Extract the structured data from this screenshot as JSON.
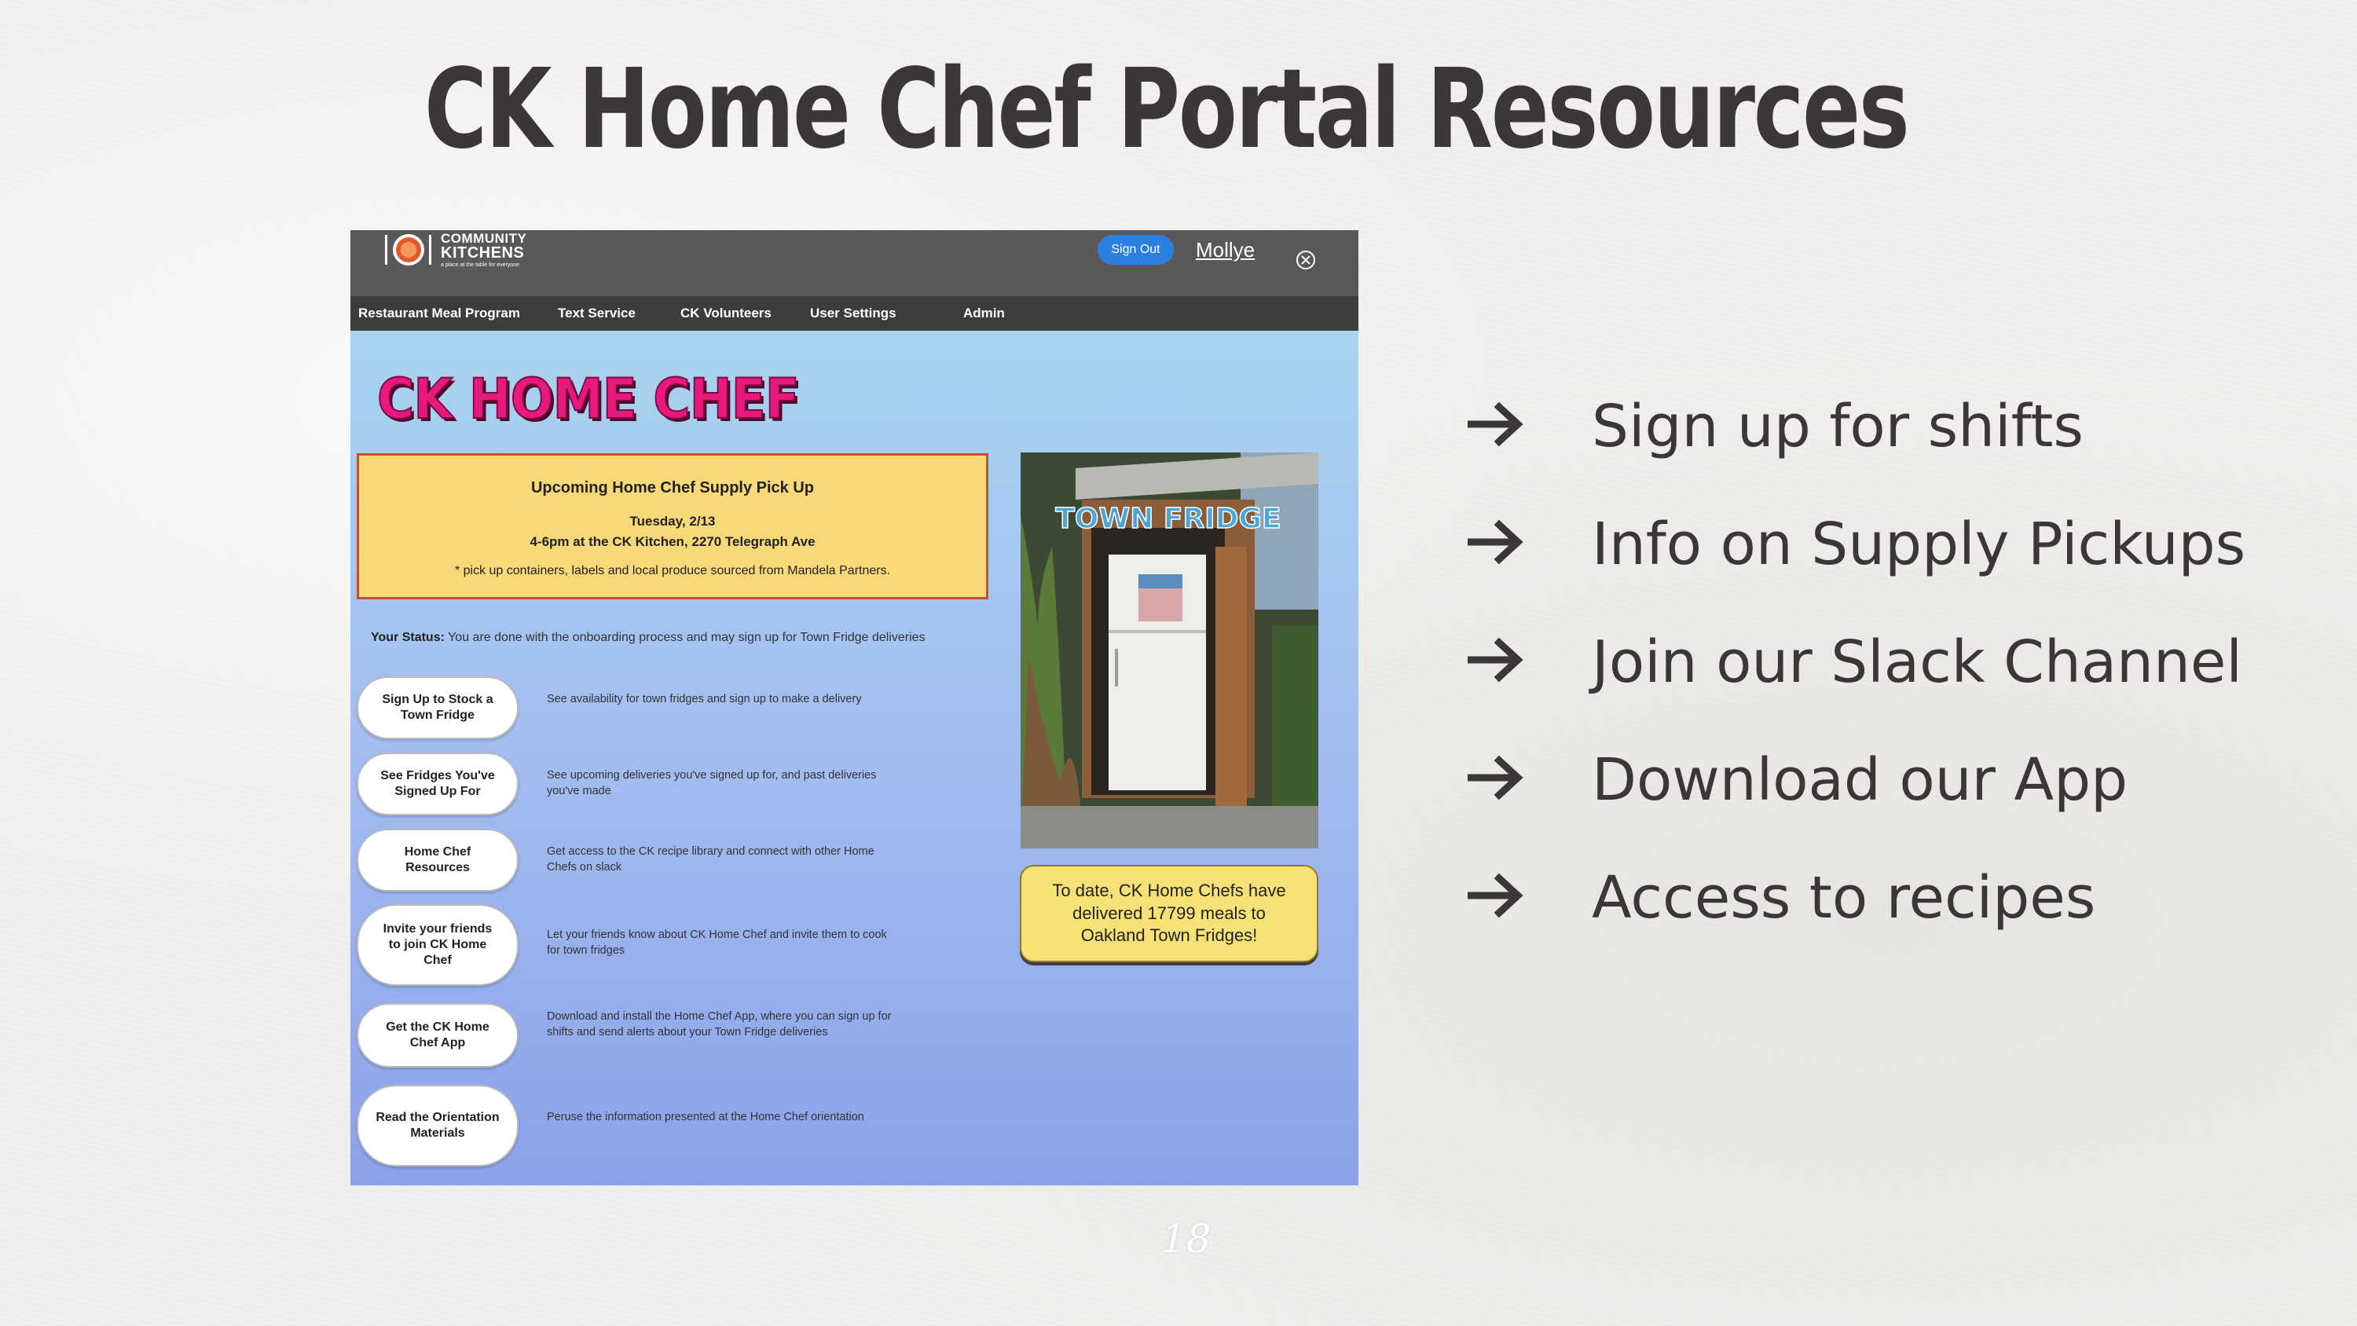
{
  "slide": {
    "title": "CK Home Chef Portal Resources",
    "page_number": "18"
  },
  "portal": {
    "logo": {
      "line1": "COMMUNITY",
      "line2": "KITCHENS",
      "tagline": "a place at the table for everyone"
    },
    "sign_out_label": "Sign Out",
    "user_name": "Mollye",
    "nav": [
      "Restaurant Meal Program",
      "Text Service",
      "CK Volunteers",
      "User Settings",
      "Admin"
    ],
    "heading": "CK HOME CHEF",
    "pickup": {
      "heading": "Upcoming Home Chef Supply Pick Up",
      "date": "Tuesday, 2/13",
      "time_location": "4-6pm at the CK Kitchen, 2270 Telegraph Ave",
      "note": "* pick up containers, labels and local produce sourced from Mandela Partners."
    },
    "status_label": "Your Status:",
    "status_text": "You are done with the onboarding process and may sign up for Town Fridge deliveries",
    "actions": [
      {
        "label": "Sign Up to Stock a Town Fridge",
        "desc": "See availability for town fridges and sign up to make a delivery"
      },
      {
        "label": "See Fridges You've Signed Up For",
        "desc": "See upcoming deliveries you've signed up for, and past deliveries you've made"
      },
      {
        "label": "Home Chef Resources",
        "desc": "Get access to the CK recipe library and connect with other Home Chefs on slack"
      },
      {
        "label": "Invite your friends to join CK Home Chef",
        "desc": "Let your friends know about CK Home Chef and invite them to cook for town fridges"
      },
      {
        "label": "Get the CK Home Chef App",
        "desc": "Download and install the Home Chef App, where you can sign up for shifts and send alerts about your Town Fridge deliveries"
      },
      {
        "label": "Read the Orientation Materials",
        "desc": "Peruse the information presented at the Home Chef orientation"
      }
    ],
    "fridge_sign": "TOWN FRIDGE",
    "meals_text": "To date, CK Home Chefs have delivered 17799 meals to Oakland Town Fridges!"
  },
  "bullets": [
    "Sign up for shifts",
    "Info on Supply Pickups",
    "Join our Slack Channel",
    "Download our App",
    "Access to recipes"
  ],
  "colors": {
    "title": "#3b3638",
    "accent_pink": "#e8197c",
    "pickup_bg": "#f8d877",
    "sign_out_blue": "#2a7fe0"
  }
}
